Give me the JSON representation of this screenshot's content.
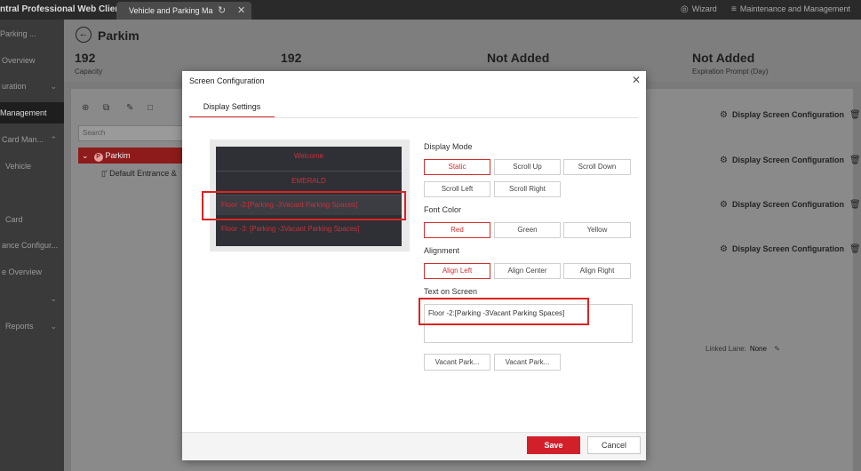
{
  "app": {
    "title": "ntral Professional Web Client"
  },
  "browser_tab": {
    "label": "Vehicle and Parking Ma",
    "refresh_icon": "refresh-icon",
    "close_icon": "close-icon"
  },
  "topbar": {
    "wizard": "Wizard",
    "maintenance": "Maintenance and Management"
  },
  "sidebar": {
    "items": [
      {
        "label": "Parking ..."
      },
      {
        "label": "Overview"
      },
      {
        "label": "uration"
      },
      {
        "label": "Management"
      },
      {
        "label": "Card Man..."
      },
      {
        "label": "Vehicle"
      },
      {
        "label": "Card"
      },
      {
        "label": "ance Configur..."
      },
      {
        "label": "e Overview"
      },
      {
        "label": ""
      },
      {
        "label": "Reports"
      }
    ]
  },
  "header": {
    "title": "Parkim",
    "stats": [
      {
        "value": "192",
        "label": "Capacity"
      },
      {
        "value": "192",
        "label": ""
      },
      {
        "value": "Not Added",
        "label": ""
      },
      {
        "value": "Not Added",
        "label": "Expiration Prompt (Day)"
      }
    ]
  },
  "tree": {
    "search_placeholder": "Search",
    "root": "Parkim",
    "root_badge": "P",
    "child": "Default Entrance &"
  },
  "rows": {
    "action_label": "Display Screen Configuration",
    "linked_lane_label": "Linked Lane:",
    "linked_lane_value": "None"
  },
  "modal": {
    "title": "Screen Configuration",
    "tab": "Display Settings",
    "preview_lines": [
      "Welcome",
      "EMERALD",
      "Floor -2:[Parking -3Vacant Parking Spaces]",
      "Floor -3: [Parking -3Vacant Parking Spaces]"
    ],
    "display_mode": {
      "label": "Display Mode",
      "options": [
        "Static",
        "Scroll Up",
        "Scroll Down",
        "Scroll Left",
        "Scroll Right"
      ],
      "selected": "Static"
    },
    "font_color": {
      "label": "Font Color",
      "options": [
        "Red",
        "Green",
        "Yellow"
      ],
      "selected": "Red"
    },
    "alignment": {
      "label": "Alignment",
      "options": [
        "Align Left",
        "Align Center",
        "Align Right"
      ],
      "selected": "Align Left"
    },
    "text_on_screen": {
      "label": "Text on Screen",
      "value": "Floor -2:[Parking -3Vacant Parking Spaces]"
    },
    "insert_buttons": [
      "Vacant Park...",
      "Vacant Park..."
    ],
    "save": "Save",
    "cancel": "Cancel"
  },
  "colors": {
    "accent": "#d22e2e",
    "screen_bg": "#2f3035",
    "screen_text": "#c9303a"
  }
}
